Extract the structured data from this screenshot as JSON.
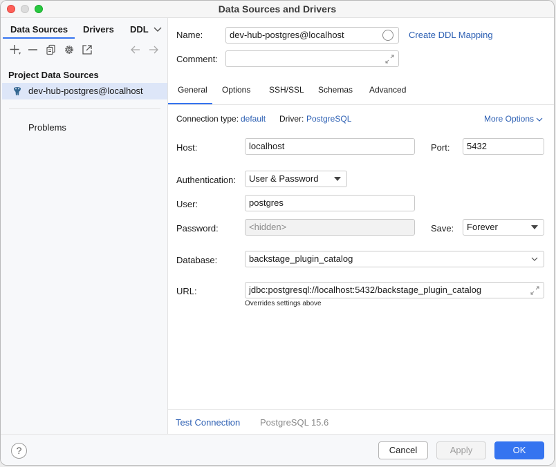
{
  "window": {
    "title": "Data Sources and Drivers"
  },
  "left_tabs": {
    "data_sources": "Data Sources",
    "drivers": "Drivers",
    "ddl": "DDL"
  },
  "left_panel": {
    "section_title": "Project Data Sources",
    "data_source": "dev-hub-postgres@localhost",
    "problems": "Problems"
  },
  "form": {
    "name_label": "Name:",
    "name_value": "dev-hub-postgres@localhost",
    "create_ddl_mapping": "Create DDL Mapping",
    "comment_label": "Comment:",
    "comment_value": ""
  },
  "tabs": {
    "general": "General",
    "options": "Options",
    "ssh_ssl": "SSH/SSL",
    "schemas": "Schemas",
    "advanced": "Advanced"
  },
  "connection": {
    "type_label": "Connection type:",
    "type_value": "default",
    "driver_label": "Driver:",
    "driver_value": "PostgreSQL",
    "more_options": "More Options"
  },
  "fields": {
    "host_label": "Host:",
    "host_value": "localhost",
    "port_label": "Port:",
    "port_value": "5432",
    "auth_label": "Authentication:",
    "auth_value": "User & Password",
    "user_label": "User:",
    "user_value": "postgres",
    "password_label": "Password:",
    "password_placeholder": "<hidden>",
    "save_label": "Save:",
    "save_value": "Forever",
    "database_label": "Database:",
    "database_value": "backstage_plugin_catalog",
    "url_label": "URL:",
    "url_value": "jdbc:postgresql://localhost:5432/backstage_plugin_catalog",
    "url_hint": "Overrides settings above"
  },
  "status": {
    "test_connection": "Test Connection",
    "version": "PostgreSQL 15.6"
  },
  "buttons": {
    "help": "?",
    "cancel": "Cancel",
    "apply": "Apply",
    "ok": "OK"
  }
}
